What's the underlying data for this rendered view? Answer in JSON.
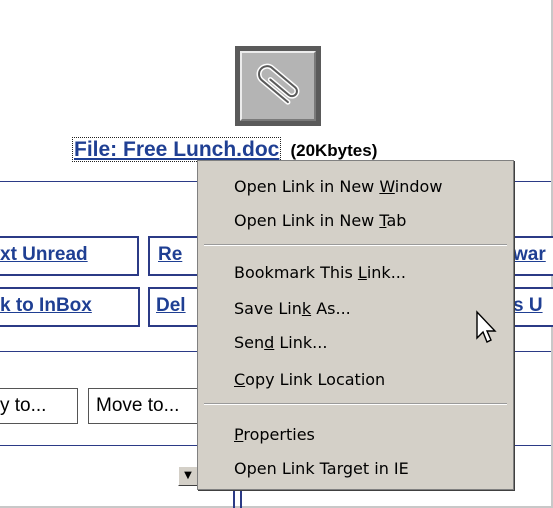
{
  "attachment": {
    "file_label": "File: Free Lunch.doc",
    "file_size": "(20Kbytes)"
  },
  "nav_buttons": {
    "next_unread": "xt Unread",
    "reply": "Re",
    "forward": "war",
    "back_to_inbox": "k to InBox",
    "delete": "Del",
    "mark_unread": "s U"
  },
  "folder_actions": {
    "copy_to": "y to...",
    "move_to": "Move to..."
  },
  "context_menu": {
    "items": [
      {
        "label": "Open Link in New Window"
      },
      {
        "label": "Open Link in New Tab"
      },
      {
        "label": "Bookmark This Link..."
      },
      {
        "label": "Save Link As..."
      },
      {
        "label": "Send Link..."
      },
      {
        "label": "Copy Link Location"
      },
      {
        "label": "Properties"
      },
      {
        "label": "Open Link Target in IE"
      }
    ]
  },
  "icons": {
    "attachment": "paperclip-icon",
    "dropdown": "chevron-down-icon",
    "pointer": "mouse-cursor-icon"
  },
  "colors": {
    "link": "#1f3f93",
    "border": "#2b3a86",
    "menu_bg": "#d4d0c8"
  }
}
